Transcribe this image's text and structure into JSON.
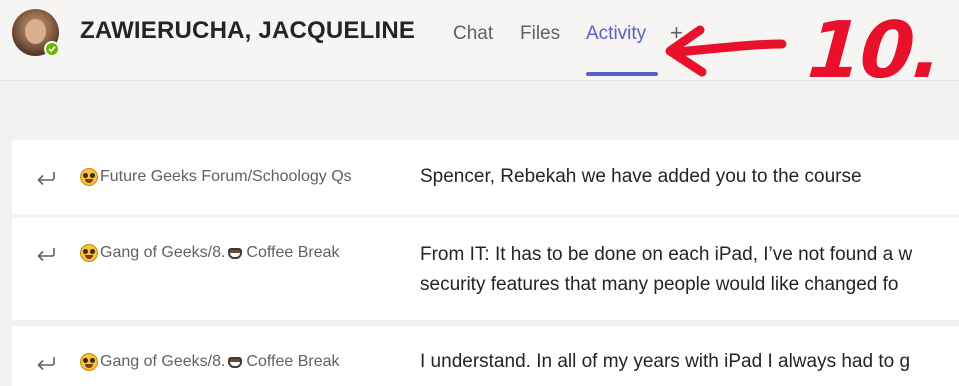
{
  "header": {
    "contact_name": "ZAWIERUCHA, JACQUELINE",
    "tabs": [
      {
        "label": "Chat",
        "active": false
      },
      {
        "label": "Files",
        "active": false
      },
      {
        "label": "Activity",
        "active": true
      }
    ],
    "add_tab_label": "+"
  },
  "annotation": {
    "text": "10.",
    "color": "#e8102a"
  },
  "colors": {
    "accent": "#5b5fc7",
    "presence": "#6bb700"
  },
  "activity": [
    {
      "icon": "reply-icon",
      "channel_parts": [
        {
          "type": "emoji",
          "name": "nerd-face-emoji"
        },
        {
          "type": "text",
          "value": "Future Geeks Forum/Schoology Qs"
        }
      ],
      "message_lines": [
        "Spencer, Rebekah we have added you to the course"
      ]
    },
    {
      "icon": "reply-icon",
      "channel_parts": [
        {
          "type": "emoji",
          "name": "nerd-face-emoji"
        },
        {
          "type": "text",
          "value": "Gang of Geeks/8."
        },
        {
          "type": "emoji",
          "name": "coffee-cup-emoji"
        },
        {
          "type": "text",
          "value": "Coffee Break"
        }
      ],
      "message_lines": [
        "From IT: It has to be done on each iPad, I’ve not found a w",
        "security features that many people would like changed fo"
      ]
    },
    {
      "icon": "reply-icon",
      "channel_parts": [
        {
          "type": "emoji",
          "name": "nerd-face-emoji"
        },
        {
          "type": "text",
          "value": "Gang of Geeks/8."
        },
        {
          "type": "emoji",
          "name": "coffee-cup-emoji"
        },
        {
          "type": "text",
          "value": "Coffee Break"
        }
      ],
      "message_lines": [
        "I understand. In all of my years with iPad I always had to g"
      ]
    }
  ]
}
